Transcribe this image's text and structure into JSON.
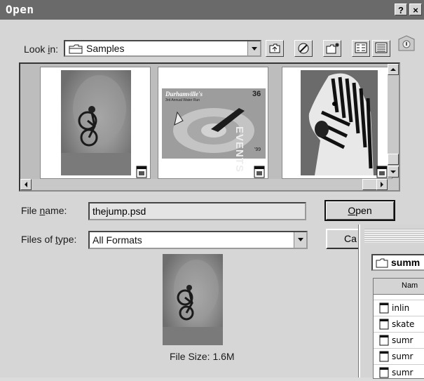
{
  "window": {
    "title": "Open",
    "help_label": "?",
    "close_label": "×"
  },
  "look_in": {
    "label_prefix": "Look ",
    "label_accel": "i",
    "label_suffix": "n:",
    "value": "Samples"
  },
  "toolbar": {
    "icons": [
      "up-folder-icon",
      "desktop-icon",
      "new-folder-icon",
      "list-view-icon",
      "details-view-icon",
      "tips-icon"
    ]
  },
  "thumbnails": [
    {
      "name": "thejump.psd"
    },
    {
      "name": "Events poster",
      "poster_title": "Durhamville's",
      "poster_subtitle": "3rd Annual Water Run",
      "poster_side_number": "36",
      "poster_side_word": "EVENTS",
      "poster_side_suffix": "'99"
    },
    {
      "name": "Zebra"
    }
  ],
  "file_name": {
    "label_prefix": "File ",
    "label_accel": "n",
    "label_suffix": "ame:",
    "value": "thejump.psd"
  },
  "files_of_type": {
    "label_prefix": "Files of ",
    "label_accel": "t",
    "label_suffix": "ype:",
    "value": "All Formats"
  },
  "buttons": {
    "open_accel": "O",
    "open_rest": "pen",
    "cancel_partial": "Ca"
  },
  "preview": {
    "file_size_label": "File Size:",
    "file_size_value": "1.6M"
  },
  "second_window": {
    "folder": "summ",
    "column_header": "Nam",
    "rows": [
      "inlin",
      "skate",
      "sumr",
      "sumr",
      "sumr"
    ]
  },
  "colors": {
    "titlebar": "#6a6a6a",
    "dialog_bg": "#d6d6d6",
    "thumb_bg": "#bdbdbd"
  }
}
